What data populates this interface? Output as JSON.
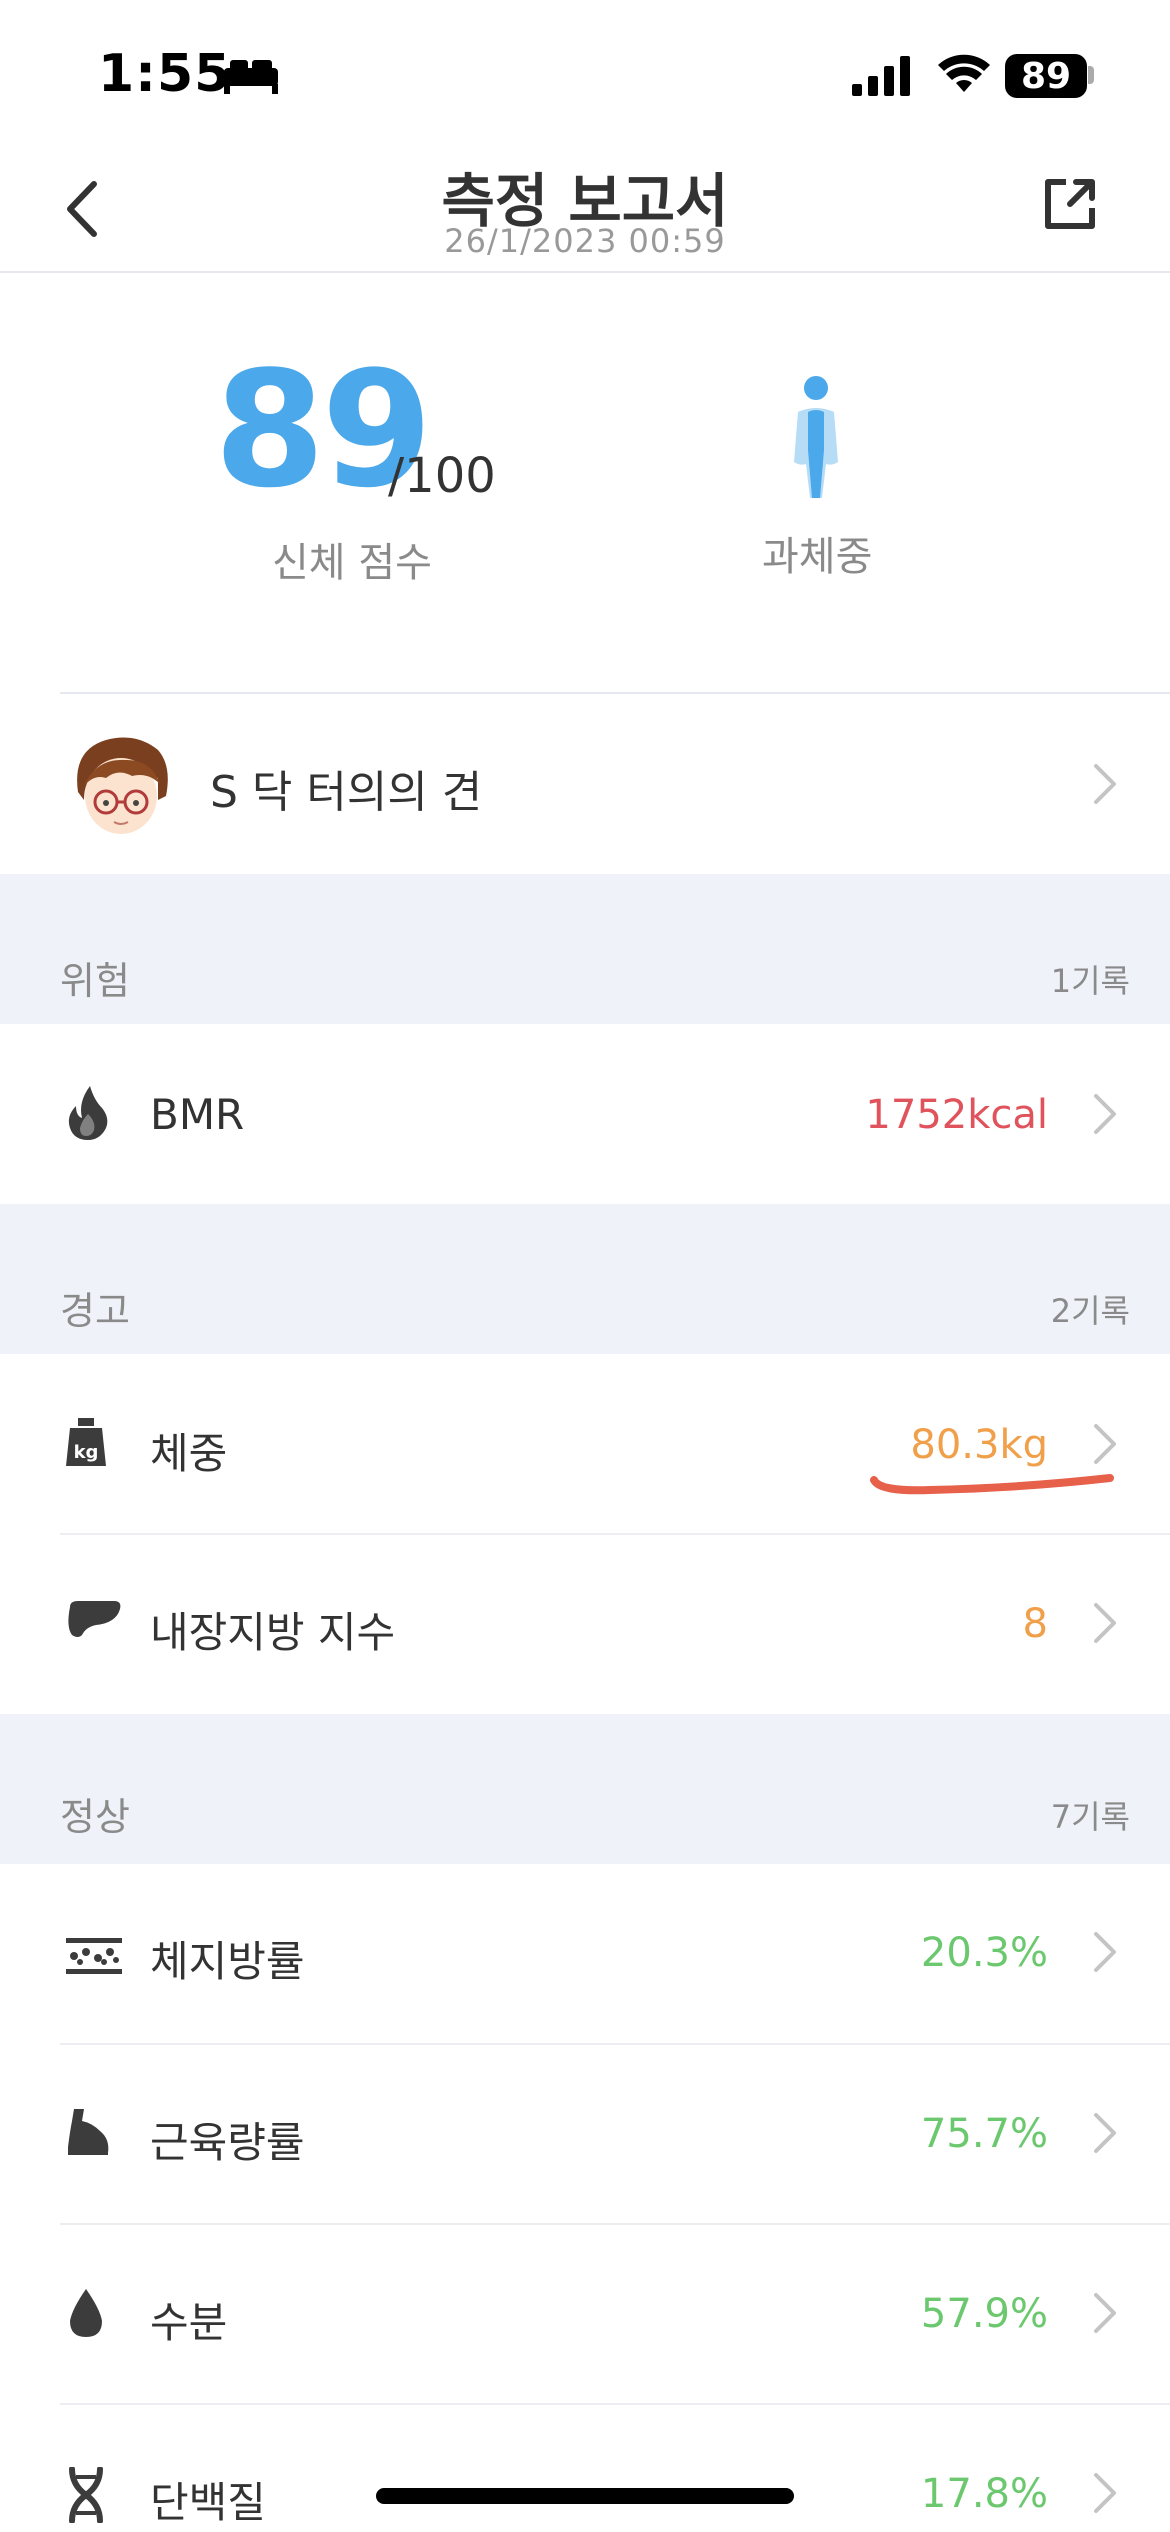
{
  "status_bar": {
    "time": "1:55",
    "battery": "89"
  },
  "nav": {
    "title": "측정 보고서",
    "subtitle": "26/1/2023 00:59"
  },
  "score": {
    "value": "89",
    "max": "/100",
    "label": "신체 점수",
    "body_type": "과체중"
  },
  "doctor": {
    "label": "S 닥 터의의 견"
  },
  "sections": {
    "risk": {
      "title": "위험",
      "count": "1기록",
      "items": [
        {
          "label": "BMR",
          "value": "1752kcal",
          "color": "#e0525c"
        }
      ]
    },
    "warning": {
      "title": "경고",
      "count": "2기록",
      "items": [
        {
          "label": "체중",
          "value": "80.3kg",
          "color": "#f0a04a"
        },
        {
          "label": "내장지방 지수",
          "value": "8",
          "color": "#f0a04a"
        }
      ]
    },
    "normal": {
      "title": "정상",
      "count": "7기록",
      "items": [
        {
          "label": "체지방률",
          "value": "20.3%",
          "color": "#6cc86e"
        },
        {
          "label": "근육량률",
          "value": "75.7%",
          "color": "#6cc86e"
        },
        {
          "label": "수분",
          "value": "57.9%",
          "color": "#6cc86e"
        },
        {
          "label": "단백질",
          "value": "17.8%",
          "color": "#6cc86e"
        }
      ]
    }
  },
  "icons": [
    "bed-icon",
    "signal-icon",
    "wifi-icon",
    "battery-icon",
    "back-icon",
    "share-icon",
    "body-figure-icon",
    "flame-icon",
    "weight-kg-icon",
    "liver-icon",
    "body-fat-icon",
    "muscle-icon",
    "water-drop-icon",
    "dna-icon",
    "chevron-right-icon"
  ]
}
